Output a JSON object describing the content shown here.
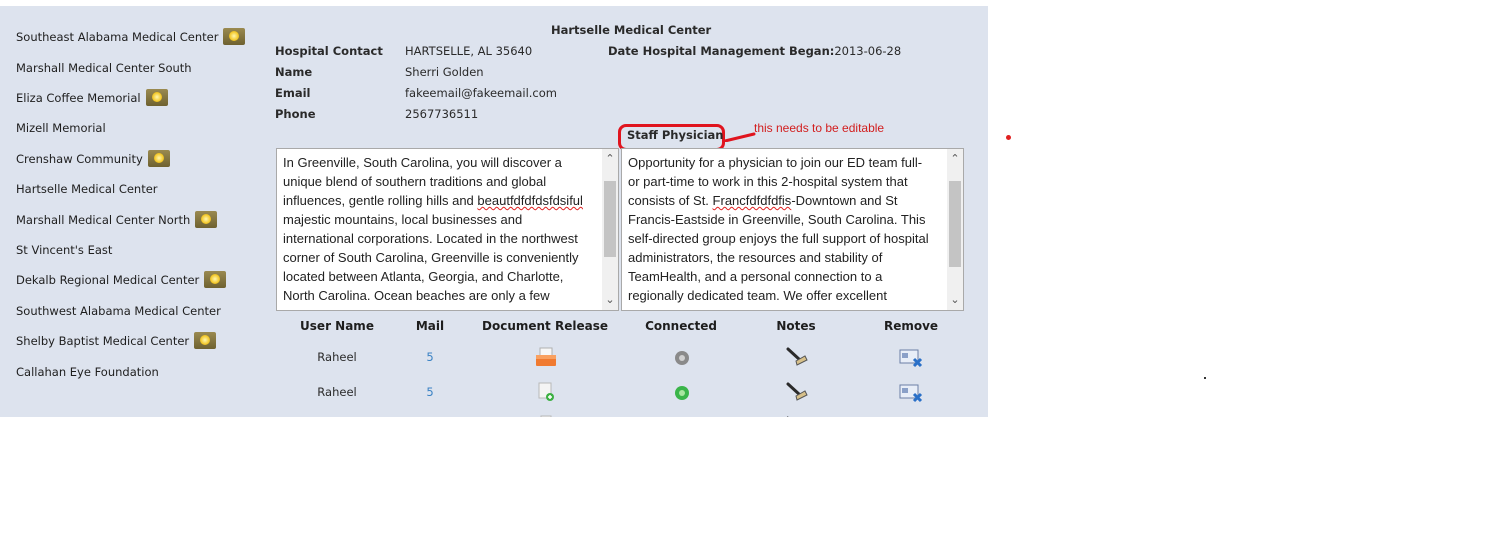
{
  "sidebar": {
    "hospitals": [
      {
        "name": "Southeast Alabama Medical Center",
        "badge": true
      },
      {
        "name": "Marshall Medical Center South",
        "badge": false
      },
      {
        "name": "Eliza Coffee Memorial",
        "badge": true
      },
      {
        "name": "Mizell Memorial",
        "badge": false
      },
      {
        "name": "Crenshaw Community",
        "badge": true
      },
      {
        "name": "Hartselle Medical Center",
        "badge": false
      },
      {
        "name": "Marshall Medical Center North",
        "badge": true
      },
      {
        "name": "St Vincent's East",
        "badge": false
      },
      {
        "name": "Dekalb Regional Medical Center",
        "badge": true
      },
      {
        "name": "Southwest Alabama Medical Center",
        "badge": false
      },
      {
        "name": "Shelby Baptist Medical Center",
        "badge": true
      },
      {
        "name": "Callahan Eye Foundation",
        "badge": false
      }
    ]
  },
  "detail": {
    "title": "Hartselle Medical Center",
    "contact_label": "Hospital Contact",
    "contact_value": "HARTSELLE, AL 35640",
    "name_label": "Name",
    "name_value": "Sherri Golden",
    "email_label": "Email",
    "email_value": "fakeemail@fakeemail.com",
    "phone_label": "Phone",
    "phone_value": "2567736511",
    "mgmt_label": "Date Hospital Management Began:",
    "mgmt_value": "2013-06-28",
    "staff_label": "Staff Physician",
    "annotation": "this needs to be editable",
    "city_text_a": "In Greenville, South Carolina, you will discover a\nunique blend of southern traditions and global\ninfluences, gentle rolling hills and ",
    "city_text_misspelled": "beautfdfdfdsfdsiful",
    "city_text_b": "\nmajestic mountains, local businesses and\ninternational corporations. Located in the northwest\ncorner of South Carolina, Greenville is conveniently\nlocated between Atlanta, Georgia, and Charlotte,\nNorth Carolina. Ocean beaches are only a few",
    "physician_text_a": "Opportunity for a physician to join our ED team full-\nor part-time to work in this 2-hospital system that\nconsists of St. ",
    "physician_text_misspelled": "Francfdfdfdfis",
    "physician_text_b": "-Downtown and St\nFrancis-Eastside in Greenville, South Carolina. This\nself-directed group enjoys the full support of hospital\nadministrators, the resources and stability of\nTeamHealth, and a personal connection to a\nregionally dedicated team. We offer excellent"
  },
  "table": {
    "headers": {
      "user": "User Name",
      "mail": "Mail",
      "doc": "Document Release",
      "connected": "Connected",
      "notes": "Notes",
      "remove": "Remove"
    },
    "rows": [
      {
        "user": "Raheel",
        "mail": "5",
        "doc_icon": "document-release-orange-icon",
        "connected_icon": "disconnected-gray-icon"
      },
      {
        "user": "Raheel",
        "mail": "5",
        "doc_icon": "document-add-icon",
        "connected_icon": "connected-green-icon"
      }
    ]
  },
  "colors": {
    "panel_bg": "#dde3ee",
    "annotation_red": "#e0141e",
    "mail_link": "#3a82c4"
  }
}
